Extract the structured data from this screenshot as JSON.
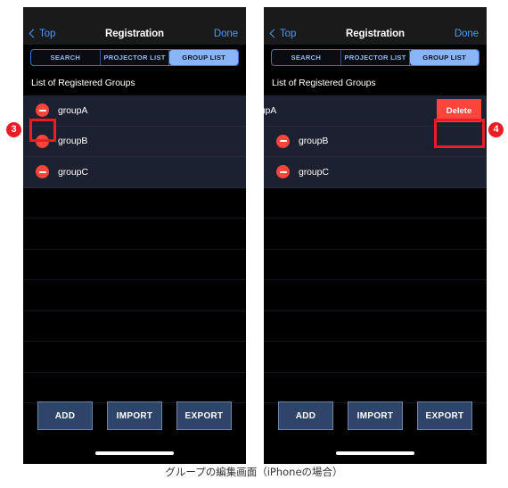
{
  "caption": "グループの編集画面（iPhoneの場合）",
  "colors": {
    "accent_blue": "#4a9bf7",
    "segment_active_bg": "#8ab4f8",
    "delete_red": "#f9453c",
    "annotation_red": "#ed1c24",
    "row_bg": "#1b2130",
    "button_bg": "#2e4468",
    "screen_bg": "#000000"
  },
  "navbar": {
    "back_label": "Top",
    "title": "Registration",
    "done_label": "Done",
    "back_icon": "chevron-left-icon"
  },
  "segmented_control": {
    "options": [
      {
        "label": "SEARCH",
        "selected": false
      },
      {
        "label": "PROJECTOR LIST",
        "selected": false
      },
      {
        "label": "GROUP LIST",
        "selected": true
      }
    ]
  },
  "section_header": "List of Registered Groups",
  "left_panel": {
    "rows": [
      {
        "label": "groupA",
        "icon": "minus-circle-icon"
      },
      {
        "label": "groupB",
        "icon": "minus-circle-icon"
      },
      {
        "label": "groupC",
        "icon": "minus-circle-icon"
      }
    ],
    "empty_row_count": 7
  },
  "right_panel": {
    "swiped_row": {
      "label": "oupA",
      "delete_label": "Delete"
    },
    "rows": [
      {
        "label": "groupB",
        "icon": "minus-circle-icon"
      },
      {
        "label": "groupC",
        "icon": "minus-circle-icon"
      }
    ],
    "empty_row_count": 7
  },
  "action_buttons": [
    {
      "label": "ADD"
    },
    {
      "label": "IMPORT"
    },
    {
      "label": "EXPORT"
    }
  ],
  "annotations": [
    {
      "badge": "❸",
      "number": "3",
      "target": "minus-circle-icon-groupA"
    },
    {
      "badge": "❹",
      "number": "4",
      "target": "delete-button"
    }
  ]
}
